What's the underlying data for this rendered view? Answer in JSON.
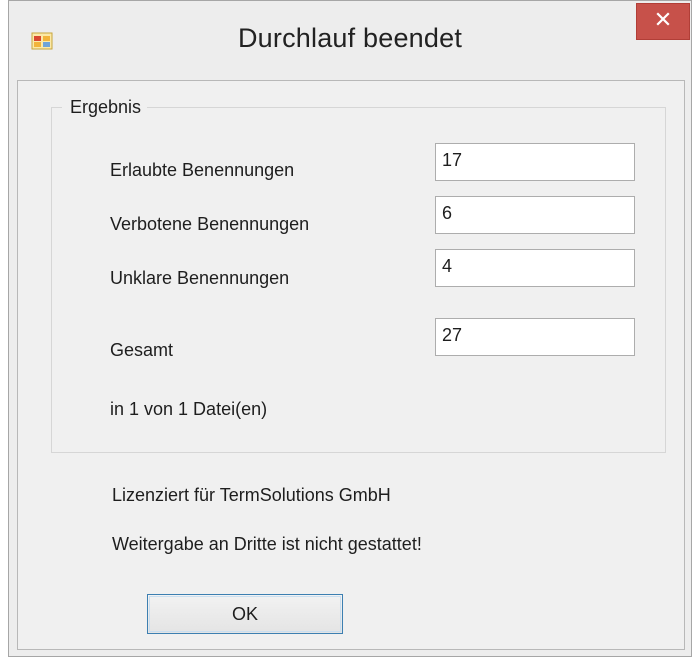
{
  "window": {
    "title": "Durchlauf beendet",
    "icons": {
      "app": "app-window-icon",
      "close": "close-icon"
    },
    "colors": {
      "close_button": "#c7514a",
      "ok_border": "#3c7fb1"
    }
  },
  "result_group": {
    "label": "Ergebnis",
    "rows": [
      {
        "label": "Erlaubte Benennungen",
        "value": "17"
      },
      {
        "label": "Verbotene Benennungen",
        "value": "6"
      },
      {
        "label": "Unklare Benennungen",
        "value": "4"
      }
    ],
    "total": {
      "label": "Gesamt",
      "value": "27"
    },
    "files_text": "in 1 von 1 Datei(en)"
  },
  "license": {
    "line1": "Lizenziert für TermSolutions GmbH",
    "line2": "Weitergabe an Dritte ist nicht gestattet!"
  },
  "buttons": {
    "ok": "OK"
  }
}
